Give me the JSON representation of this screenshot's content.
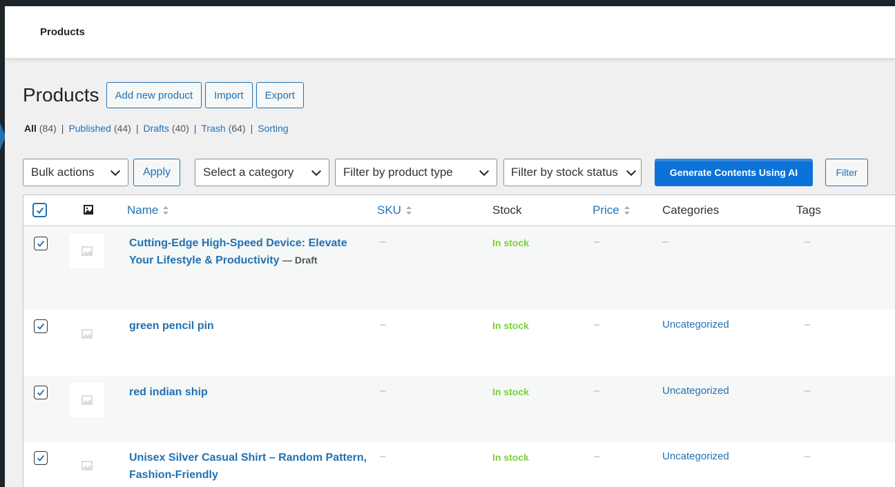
{
  "header": {
    "title": "Products"
  },
  "page": {
    "title": "Products",
    "actions": [
      "Add new product",
      "Import",
      "Export"
    ]
  },
  "views": [
    {
      "label": "All",
      "count": "(84)",
      "current": true
    },
    {
      "label": "Published",
      "count": "(44)"
    },
    {
      "label": "Drafts",
      "count": "(40)"
    },
    {
      "label": "Trash",
      "count": "(64)"
    },
    {
      "label": "Sorting",
      "count": ""
    }
  ],
  "separator": "|",
  "tablenav": {
    "bulk_actions": "Bulk actions",
    "apply": "Apply",
    "category": "Select a category",
    "product_type": "Filter by product type",
    "stock_status": "Filter by stock status",
    "generate_ai": "Generate Contents Using AI",
    "filter": "Filter"
  },
  "columns": {
    "name": "Name",
    "sku": "SKU",
    "stock": "Stock",
    "price": "Price",
    "categories": "Categories",
    "tags": "Tags"
  },
  "rows": [
    {
      "name": "Cutting-Edge High-Speed Device: Elevate Your Lifestyle & Productivity",
      "state": "— Draft",
      "sku": "–",
      "stock": "In stock",
      "price": "–",
      "category": "–",
      "tags": "–",
      "checked": true
    },
    {
      "name": "green pencil pin",
      "state": "",
      "sku": "–",
      "stock": "In stock",
      "price": "–",
      "category": "Uncategorized",
      "tags": "–",
      "checked": true
    },
    {
      "name": "red indian ship",
      "state": "",
      "sku": "–",
      "stock": "In stock",
      "price": "–",
      "category": "Uncategorized",
      "tags": "–",
      "checked": true
    },
    {
      "name": "Unisex Silver Casual Shirt – Random Pattern, Fashion-Friendly",
      "state": "",
      "sku": "–",
      "stock": "In stock",
      "price": "–",
      "category": "Uncategorized",
      "tags": "–",
      "checked": true
    }
  ],
  "colors": {
    "link": "#2271b1",
    "in_stock": "#7ad03a",
    "primary_button": "#0b72d8",
    "admin_bar": "#1d2327"
  }
}
